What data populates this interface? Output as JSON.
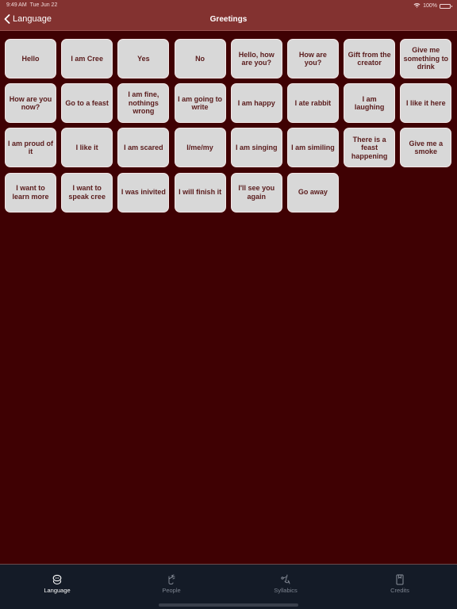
{
  "status_bar": {
    "time": "9:49 AM",
    "date": "Tue Jun 22",
    "battery": "100%",
    "wifi_icon": "wifi-icon",
    "battery_icon": "battery-icon"
  },
  "nav": {
    "back_label": "Language",
    "title": "Greetings"
  },
  "phrases": [
    "Hello",
    "I am Cree",
    "Yes",
    "No",
    "Hello, how are you?",
    "How are you?",
    "Gift from the creator",
    "Give me something to drink",
    "How are you now?",
    "Go to a feast",
    "I am fine, nothings wrong",
    "I am going to write",
    "I am happy",
    "I ate rabbit",
    "I am laughing",
    "I like it here",
    "I am proud of it",
    "I like it",
    "I am scared",
    "I/me/my",
    "I am singing",
    "I am similing",
    "There is a feast happening",
    "Give me a smoke",
    "I want to learn more",
    "I want to speak cree",
    "I was inivited",
    "I will finish it",
    "I'll see you again",
    "Go away"
  ],
  "tabs": [
    {
      "label": "Language",
      "icon": "chat-bubbles-icon",
      "active": true
    },
    {
      "label": "People",
      "icon": "people-icon",
      "active": false
    },
    {
      "label": "Syllabics",
      "icon": "syllabics-icon",
      "active": false
    },
    {
      "label": "Credits",
      "icon": "book-icon",
      "active": false
    }
  ],
  "colors": {
    "header": "#833230",
    "background": "#3f0103",
    "button": "#d8d8d8",
    "button_text": "#5a1c1c",
    "tabbar": "#141b27"
  }
}
